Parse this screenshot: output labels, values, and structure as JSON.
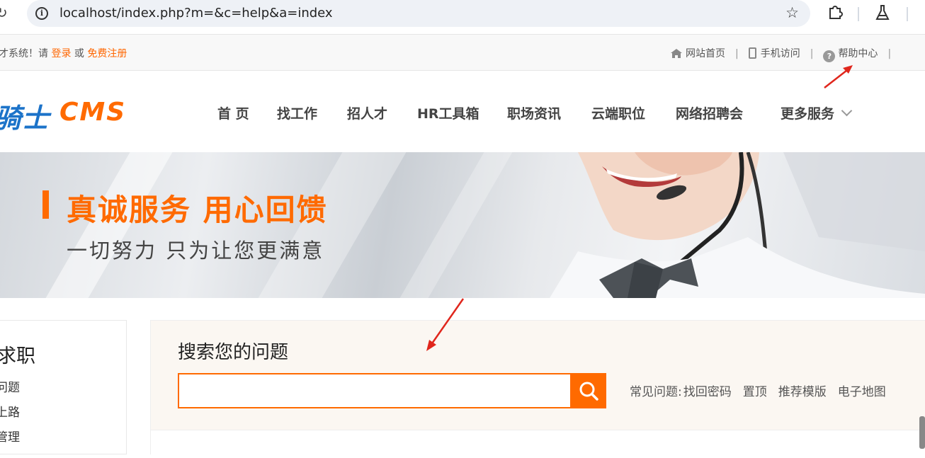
{
  "browser": {
    "url": "localhost/index.php?m=&c=help&a=index",
    "icons": [
      "reload-icon",
      "info-icon",
      "star-icon",
      "extensions-icon",
      "labs-icon"
    ]
  },
  "topbar": {
    "welcome_prefix": "才系统！请 ",
    "login": "登录",
    "or": " 或 ",
    "register": "免费注册",
    "links": [
      {
        "label": "网站首页",
        "icon": "home-icon"
      },
      {
        "label": "手机访问",
        "icon": "phone-icon"
      },
      {
        "label": "帮助中心",
        "icon": "help-icon"
      }
    ],
    "separator": "|"
  },
  "header": {
    "logo_cn": "骑士",
    "logo_en": "CMS",
    "nav": [
      "首 页",
      "找工作",
      "招人才",
      "HR工具箱",
      "职场资讯",
      "云端职位",
      "网络招聘会",
      "更多服务"
    ]
  },
  "banner": {
    "title": "真诚服务 用心回馈",
    "subtitle": "一切努力 只为让您更满意",
    "colors": {
      "accent": "#ff6a00"
    }
  },
  "sidebar": {
    "heading": "求职",
    "items": [
      "问题",
      "上路",
      "管理"
    ]
  },
  "search": {
    "title": "搜索您的问题",
    "value": "",
    "button_icon": "search-icon",
    "faq_label": "常见问题:",
    "faq_items": [
      "找回密码",
      "置顶",
      "推荐模版",
      "电子地图"
    ]
  }
}
